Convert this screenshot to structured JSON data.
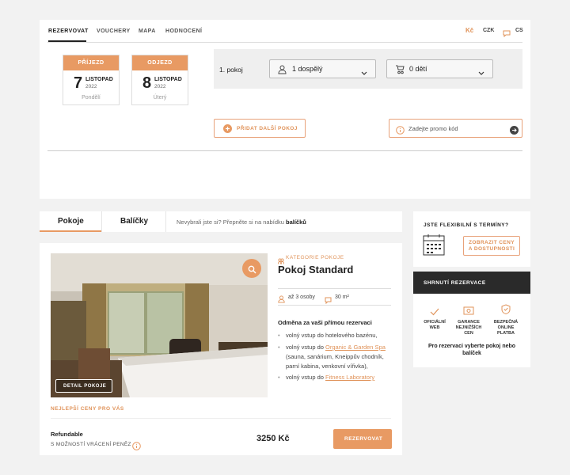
{
  "nav": {
    "tabs": [
      "REZERVOVAT",
      "VOUCHERY",
      "MAPA",
      "HODNOCENÍ"
    ],
    "currency_symbol": "Kč",
    "currency_code": "CZK",
    "language": "CS"
  },
  "arrival": {
    "label": "PŘÍJEZD",
    "day": "7",
    "month": "LISTOPAD",
    "year": "2022",
    "weekday": "Pondělí"
  },
  "departure": {
    "label": "ODJEZD",
    "day": "8",
    "month": "LISTOPAD",
    "year": "2022",
    "weekday": "Úterý"
  },
  "room_row": {
    "label": "1. pokoj",
    "adults": "1 dospělý",
    "children": "0 dětí"
  },
  "add_room_button": "PŘIDAT DALŠÍ POKOJ",
  "promo_placeholder": "Zadejte promo kód",
  "room_tabs": {
    "rooms": "Pokoje",
    "packages": "Balíčky",
    "hint_text": "Nevybrali jste si? Přepněte si na nabídku ",
    "hint_bold": "balíčků"
  },
  "room": {
    "category_label": "KATEGORIE POKOJE",
    "name": "Pokoj Standard",
    "capacity": "až 3 osoby",
    "area": "30 m²",
    "detail_button": "DETAIL POKOJE",
    "benefits_title": "Odměna za vaši přímou rezervaci",
    "benefit_1": "volný vstup do hotelového bazénu,",
    "benefit_2_prefix": "volný vstup do ",
    "benefit_2_link": "Organic & Garden Spa",
    "benefit_2_suffix_1": "(sauna, sanárium, Kneippův chodník,",
    "benefit_2_suffix_2": "parní kabina, venkovní vířivka),",
    "benefit_3_prefix": "volný vstup do ",
    "benefit_3_link": "Fitness Laboratory",
    "best_prices": "NEJLEPŠÍ CENY PRO VÁS",
    "rate_name": "Refundable",
    "rate_sub": "S MOŽNOSTÍ VRÁCENÍ PENĚZ",
    "price": "3250 Kč",
    "book_button": "REZERVOVAT"
  },
  "flexible": {
    "title": "JSTE FLEXIBILNÍ S TERMÍNY?",
    "button_line1": "ZOBRAZIT CENY",
    "button_line2": "A DOSTUPNOSTI"
  },
  "summary": {
    "title": "SHRNUTÍ REZERVACE",
    "feature_1_line1": "OFICIÁLNÍ",
    "feature_1_line2": "WEB",
    "feature_2_line1": "GARANCE",
    "feature_2_line2": "NEJNIŽŠÍCH",
    "feature_2_line3": "CEN",
    "feature_3_line1": "BEZPEČNÁ",
    "feature_3_line2": "ONLINE",
    "feature_3_line3": "PLATBA",
    "note_line1": "Pro rezervaci vyberte pokoj nebo",
    "note_line2": "balíček"
  },
  "colors": {
    "accent": "#e0935a",
    "accent_fill": "#e89a63",
    "dark": "#2a2a2a"
  }
}
